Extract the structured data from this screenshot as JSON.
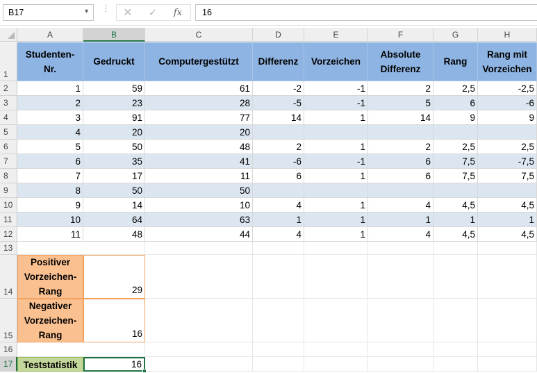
{
  "name_box": "B17",
  "formula_bar": {
    "value": "16",
    "fx_label": "fx"
  },
  "columns": [
    "A",
    "B",
    "C",
    "D",
    "E",
    "F",
    "G",
    "H"
  ],
  "rows": [
    "1",
    "2",
    "3",
    "4",
    "5",
    "6",
    "7",
    "8",
    "9",
    "10",
    "11",
    "12",
    "13",
    "14",
    "15",
    "16",
    "17"
  ],
  "headers": [
    "Studenten-Nr.",
    "Gedruckt",
    "Computergestützt",
    "Differenz",
    "Vorzeichen",
    "Absolute Differenz",
    "Rang",
    "Rang mit Vorzeichen"
  ],
  "data_rows": [
    [
      "1",
      "59",
      "61",
      "-2",
      "-1",
      "2",
      "2,5",
      "-2,5"
    ],
    [
      "2",
      "23",
      "28",
      "-5",
      "-1",
      "5",
      "6",
      "-6"
    ],
    [
      "3",
      "91",
      "77",
      "14",
      "1",
      "14",
      "9",
      "9"
    ],
    [
      "4",
      "20",
      "20",
      "",
      "",
      "",
      "",
      ""
    ],
    [
      "5",
      "50",
      "48",
      "2",
      "1",
      "2",
      "2,5",
      "2,5"
    ],
    [
      "6",
      "35",
      "41",
      "-6",
      "-1",
      "6",
      "7,5",
      "-7,5"
    ],
    [
      "7",
      "17",
      "11",
      "6",
      "1",
      "6",
      "7,5",
      "7,5"
    ],
    [
      "8",
      "50",
      "50",
      "",
      "",
      "",
      "",
      ""
    ],
    [
      "9",
      "14",
      "10",
      "4",
      "1",
      "4",
      "4,5",
      "4,5"
    ],
    [
      "10",
      "64",
      "63",
      "1",
      "1",
      "1",
      "1",
      "1"
    ],
    [
      "11",
      "48",
      "44",
      "4",
      "1",
      "4",
      "4,5",
      "4,5"
    ]
  ],
  "summary": {
    "pos_label": "Positiver Vorzeichen-Rang",
    "pos_value": "29",
    "neg_label": "Negativer Vorzeichen-Rang",
    "neg_value": "16",
    "stat_label": "Teststatistik",
    "stat_value": "16"
  },
  "colors": {
    "header_fill": "#8eb4e3",
    "band_fill": "#dce6f1",
    "orange_fill": "#fac090",
    "green_fill": "#c4d79b",
    "selection": "#217346"
  }
}
